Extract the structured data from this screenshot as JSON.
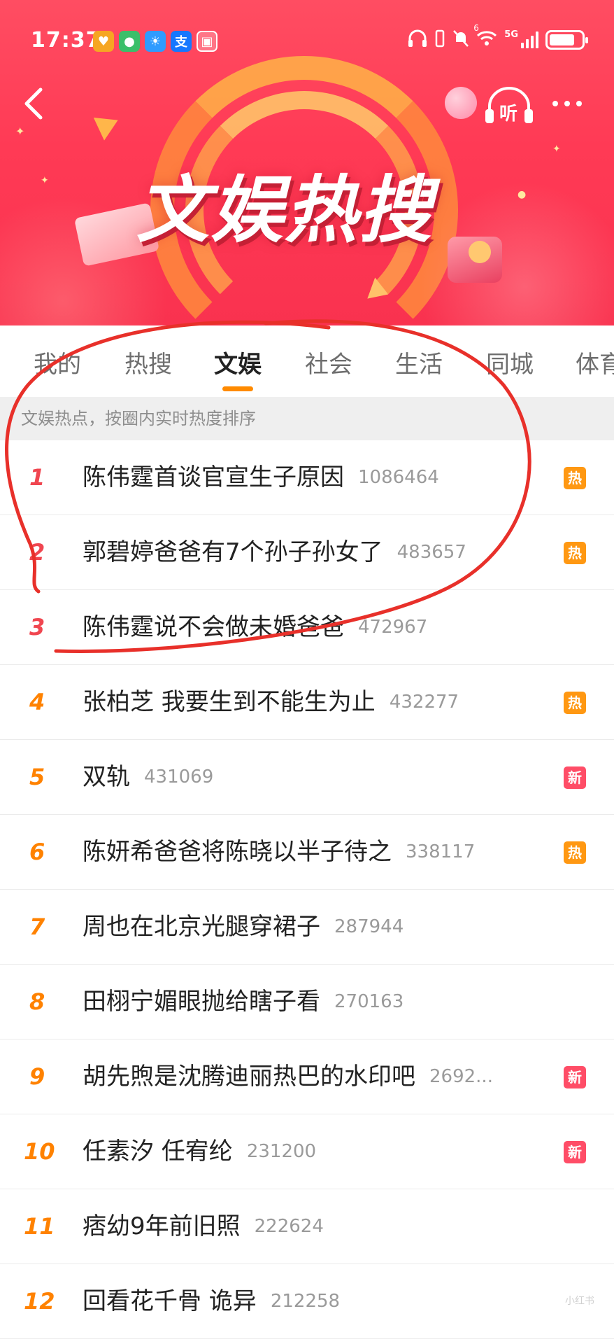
{
  "status_bar": {
    "time": "17:37",
    "notification_icons": [
      {
        "name": "heart-app-icon",
        "glyph": "♥",
        "color": "#f6a623"
      },
      {
        "name": "chat-app-icon",
        "glyph": "●",
        "color": "#3bbf6a"
      },
      {
        "name": "weather-app-icon",
        "glyph": "☀",
        "color": "#2f9bff"
      },
      {
        "name": "alipay-icon",
        "glyph": "支",
        "color": "#1677ff"
      },
      {
        "name": "gallery-icon",
        "glyph": "▣",
        "color": "#ffffff"
      }
    ],
    "network_label": "5G",
    "wifi_label": "6",
    "battery_level": 0.8
  },
  "header": {
    "title": "文娱热搜",
    "listen_label": "听",
    "back_icon": "chevron-left-icon",
    "more_icon": "more-dots-icon"
  },
  "tabs": [
    {
      "label": "我的",
      "active": false
    },
    {
      "label": "热搜",
      "active": false
    },
    {
      "label": "文娱",
      "active": true
    },
    {
      "label": "社会",
      "active": false
    },
    {
      "label": "生活",
      "active": false
    },
    {
      "label": "同城",
      "active": false
    },
    {
      "label": "体育",
      "active": false
    }
  ],
  "subheader": "文娱热点，按圈内实时热度排序",
  "list": [
    {
      "rank": "1",
      "title": "陈伟霆首谈官宣生子原因",
      "count": "1086464",
      "badge": "热",
      "badge_type": "hot"
    },
    {
      "rank": "2",
      "title": "郭碧婷爸爸有7个孙子孙女了",
      "count": "483657",
      "badge": "热",
      "badge_type": "hot"
    },
    {
      "rank": "3",
      "title": "陈伟霆说不会做未婚爸爸",
      "count": "472967",
      "badge": "",
      "badge_type": ""
    },
    {
      "rank": "4",
      "title": "张柏芝 我要生到不能生为止",
      "count": "432277",
      "badge": "热",
      "badge_type": "hot"
    },
    {
      "rank": "5",
      "title": "双轨",
      "count": "431069",
      "badge": "新",
      "badge_type": "new"
    },
    {
      "rank": "6",
      "title": "陈妍希爸爸将陈晓以半子待之",
      "count": "338117",
      "badge": "热",
      "badge_type": "hot"
    },
    {
      "rank": "7",
      "title": "周也在北京光腿穿裙子",
      "count": "287944",
      "badge": "",
      "badge_type": ""
    },
    {
      "rank": "8",
      "title": "田栩宁媚眼抛给瞎子看",
      "count": "270163",
      "badge": "",
      "badge_type": ""
    },
    {
      "rank": "9",
      "title": "胡先煦是沈腾迪丽热巴的水印吧",
      "count": "2692...",
      "badge": "新",
      "badge_type": "new"
    },
    {
      "rank": "10",
      "title": "任素汐 任宥纶",
      "count": "231200",
      "badge": "新",
      "badge_type": "new"
    },
    {
      "rank": "11",
      "title": "痞幼9年前旧照",
      "count": "222624",
      "badge": "",
      "badge_type": ""
    },
    {
      "rank": "12",
      "title": "回看花千骨 诡异",
      "count": "212258",
      "badge": "",
      "badge_type": ""
    }
  ],
  "colors": {
    "banner_red": "#ff3a55",
    "tab_underline": "#ff8a00",
    "rank_top": "#f04650",
    "rank_normal": "#ff8200",
    "badge_hot": "#ff9812",
    "badge_new": "#ff4d67",
    "annotation_red": "#e8302a"
  }
}
